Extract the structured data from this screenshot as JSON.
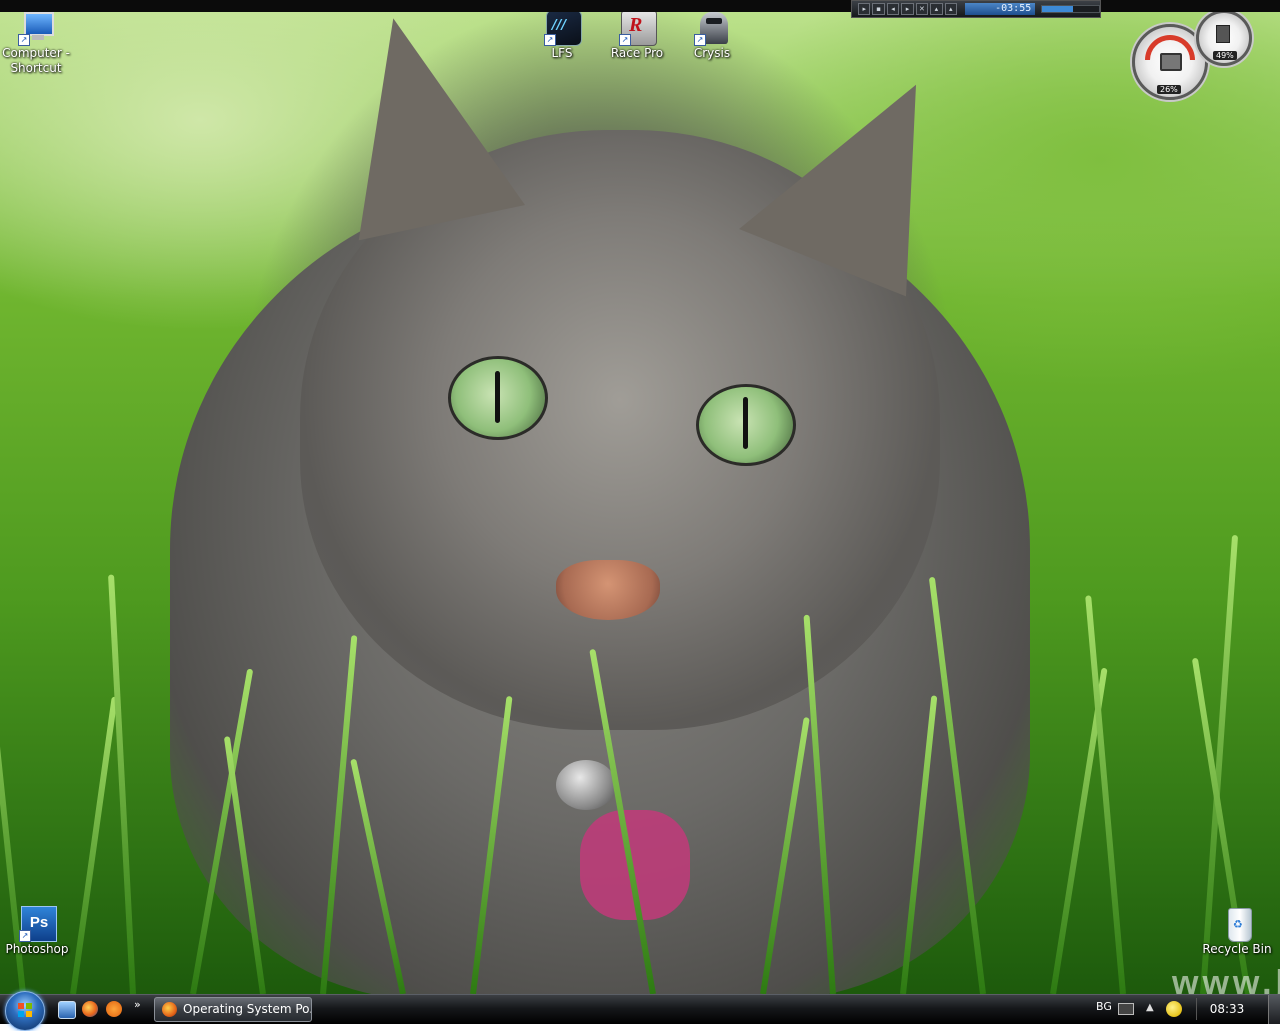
{
  "desktop": {
    "icons": [
      {
        "label": "Computer -\nShortcut",
        "icon": "computer-icon"
      },
      {
        "label": "LFS",
        "icon": "lfs-icon"
      },
      {
        "label": "Race Pro",
        "icon": "race-pro-icon"
      },
      {
        "label": "Crysis",
        "icon": "crysis-icon"
      },
      {
        "label": "Photoshop",
        "icon": "photoshop-icon"
      },
      {
        "label": "Recycle Bin",
        "icon": "recycle-bin-icon"
      }
    ],
    "watermark": "www.b"
  },
  "media_bar": {
    "buttons": [
      "play",
      "stop",
      "prev",
      "next",
      "shuffle",
      "eject"
    ],
    "time": "-03:55",
    "volume": 0.55
  },
  "gadgets": {
    "cpu_meter": {
      "cpu": "26%",
      "memory": "49%"
    }
  },
  "taskbar": {
    "start_icon": "windows-orb-icon",
    "quick_launch": [
      "show-desktop-icon",
      "firefox-icon",
      "avast-icon"
    ],
    "overflow": "»",
    "window_button": "Operating System Po...",
    "language": "BG",
    "clock": "08:33",
    "colors": {
      "taskbar": "#16181b",
      "accent": "#2f6fbf"
    }
  }
}
